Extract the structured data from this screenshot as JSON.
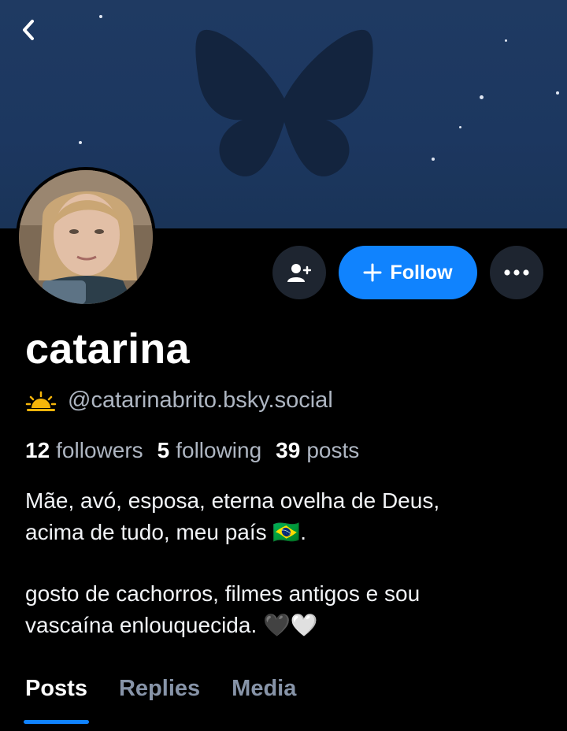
{
  "profile": {
    "display_name": "catarina",
    "handle": "@catarinabrito.bsky.social",
    "handle_badge": "sunrise-icon",
    "avatar": "profile-photo"
  },
  "actions": {
    "add_user": "add-user-icon",
    "follow_label": "Follow",
    "more": "more-icon"
  },
  "stats": {
    "followers_count": "12",
    "followers_label": "followers",
    "following_count": "5",
    "following_label": "following",
    "posts_count": "39",
    "posts_label": "posts"
  },
  "bio": {
    "line1": "Mãe, avó, esposa, eterna ovelha de Deus,",
    "line2": "acima de tudo, meu país 🇧🇷.",
    "line3": "gosto de cachorros, filmes antigos e sou",
    "line4": "vascaína enlouquecida. 🖤🤍"
  },
  "tabs": [
    "Posts",
    "Replies",
    "Media"
  ],
  "active_tab": "Posts",
  "colors": {
    "accent": "#1083fe",
    "background": "#000000",
    "banner": "#1d385f",
    "muted_text": "#aeb6c2"
  }
}
